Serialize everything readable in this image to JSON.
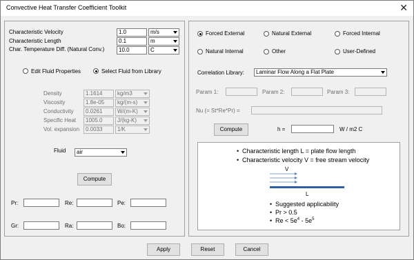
{
  "window": {
    "title": "Convective Heat Transfer Coefficient Toolkit",
    "close_glyph": "✕"
  },
  "inputs": {
    "velocity": {
      "label": "Characteristic Velocity",
      "value": "1.0",
      "unit": "m/s"
    },
    "length": {
      "label": "Characteristic Length",
      "value": "0.1",
      "unit": "m"
    },
    "tempdiff": {
      "label": "Char. Temperature Diff. (Natural Conv.)",
      "value": "10.0",
      "unit": "C"
    }
  },
  "fluid_mode": {
    "edit_label": "Edit Fluid Properties",
    "library_label": "Select Fluid from Library",
    "selected": "library"
  },
  "properties": [
    {
      "label": "Density",
      "value": "1.1614",
      "unit": "kg/m3"
    },
    {
      "label": "Viscosity",
      "value": "1.8e-05",
      "unit": "kg/(m-s)"
    },
    {
      "label": "Conductivity",
      "value": "0.0261",
      "unit": "W/(m-K)"
    },
    {
      "label": "Specific Heat",
      "value": "1005.0",
      "unit": "J/(kg-K)"
    },
    {
      "label": "Vol. expansion",
      "value": "0.0033",
      "unit": "1/K"
    }
  ],
  "fluid": {
    "label": "Fluid",
    "value": "air"
  },
  "compute_left": "Compute",
  "dimensionless": {
    "pr": {
      "label": "Pr:",
      "value": ""
    },
    "re": {
      "label": "Re:",
      "value": ""
    },
    "pe": {
      "label": "Pe:",
      "value": ""
    },
    "gr": {
      "label": "Gr:",
      "value": ""
    },
    "ra": {
      "label": "Ra:",
      "value": ""
    },
    "bo": {
      "label": "Bo:",
      "value": ""
    }
  },
  "flow_types": [
    {
      "label": "Forced External",
      "selected": true
    },
    {
      "label": "Natural External",
      "selected": false
    },
    {
      "label": "Forced Internal",
      "selected": false
    },
    {
      "label": "Natural Internal",
      "selected": false
    },
    {
      "label": "Other",
      "selected": false
    },
    {
      "label": "User-Defined",
      "selected": false
    }
  ],
  "correlation": {
    "label": "Correlation Library:",
    "value": "Laminar Flow Along a Flat Plate"
  },
  "params": {
    "p1": {
      "label": "Param 1:",
      "value": ""
    },
    "p2": {
      "label": "Param 2:",
      "value": ""
    },
    "p3": {
      "label": "Param 3:",
      "value": ""
    }
  },
  "nu": {
    "label": "Nu (= St*Re*Pr) =",
    "value": ""
  },
  "compute_right": "Compute",
  "h": {
    "label": "h =",
    "value": "",
    "unit": "W / m2 C"
  },
  "info": {
    "line1": "Characteristic length L = plate flow length",
    "line2": "Characteristic velocity V = free stream velocity",
    "diagram_v": "V",
    "diagram_l": "L",
    "app_title": "Suggested applicability",
    "pr_cond": "Pr > 0.5",
    "re_prefix": "Re < 5e",
    "re_exp1": "4",
    "re_mid": " - 5e",
    "re_exp2": "5"
  },
  "footer": {
    "apply": "Apply",
    "reset": "Reset",
    "cancel": "Cancel"
  },
  "colors": {
    "plate": "#2e5fa8",
    "arrows": "#5b7fc4"
  }
}
